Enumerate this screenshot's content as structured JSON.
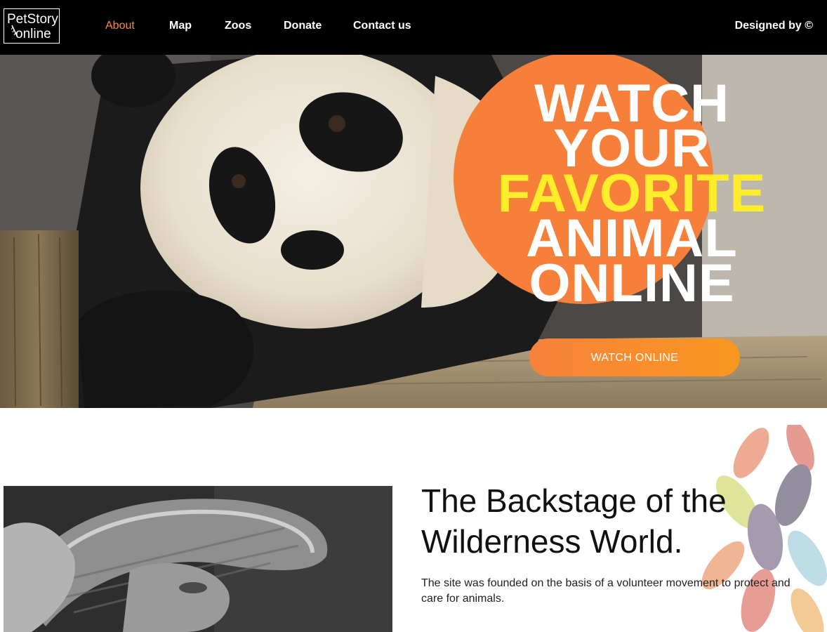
{
  "header": {
    "logo_line1": "PetStory",
    "logo_line2": "online",
    "nav": [
      {
        "label": "About",
        "active": true
      },
      {
        "label": "Map",
        "active": false
      },
      {
        "label": "Zoos",
        "active": false
      },
      {
        "label": "Donate",
        "active": false
      },
      {
        "label": "Contact us",
        "active": false
      }
    ],
    "credit": "Designed by ©"
  },
  "hero": {
    "headline": [
      "WATCH",
      "YOUR",
      "FAVORITE",
      "ANIMAL",
      "ONLINE"
    ],
    "cta_label": "WATCH ONLINE"
  },
  "about": {
    "title_line1": "The Backstage of the",
    "title_line2": "Wilderness World.",
    "text": "The site was founded on the basis of a volunteer movement to protect and care for animals."
  },
  "colors": {
    "accent": "#f6803a",
    "highlight": "#ffec2a",
    "header_bg": "#000000"
  }
}
